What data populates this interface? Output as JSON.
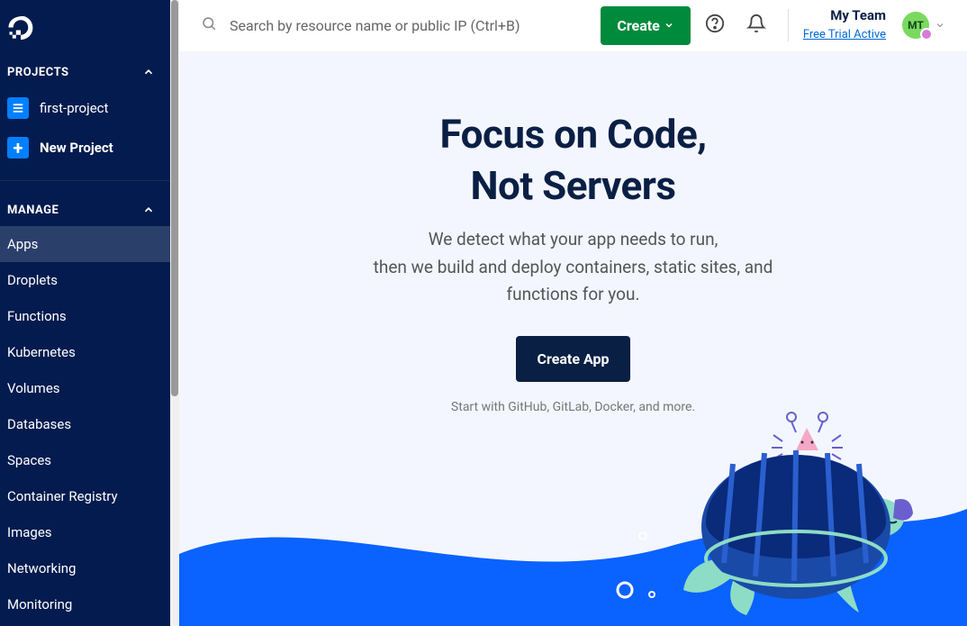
{
  "sidebar": {
    "sections": {
      "projects_label": "PROJECTS",
      "manage_label": "MANAGE"
    },
    "projects": [
      {
        "label": "first-project"
      },
      {
        "label": "New Project"
      }
    ],
    "manage_items": [
      "Apps",
      "Droplets",
      "Functions",
      "Kubernetes",
      "Volumes",
      "Databases",
      "Spaces",
      "Container Registry",
      "Images",
      "Networking",
      "Monitoring"
    ]
  },
  "topbar": {
    "search_placeholder": "Search by resource name or public IP (Ctrl+B)",
    "create_label": "Create",
    "team_name": "My Team",
    "trial_text": "Free Trial Active",
    "avatar_initials": "MT"
  },
  "hero": {
    "title_line1": "Focus on Code,",
    "title_line2": "Not Servers",
    "sub_line1": "We detect what your app needs to run,",
    "sub_line2": "then we build and deploy containers, static sites, and",
    "sub_line3": "functions for you.",
    "cta_label": "Create App",
    "start_with": "Start with GitHub, GitLab, Docker, and more."
  }
}
